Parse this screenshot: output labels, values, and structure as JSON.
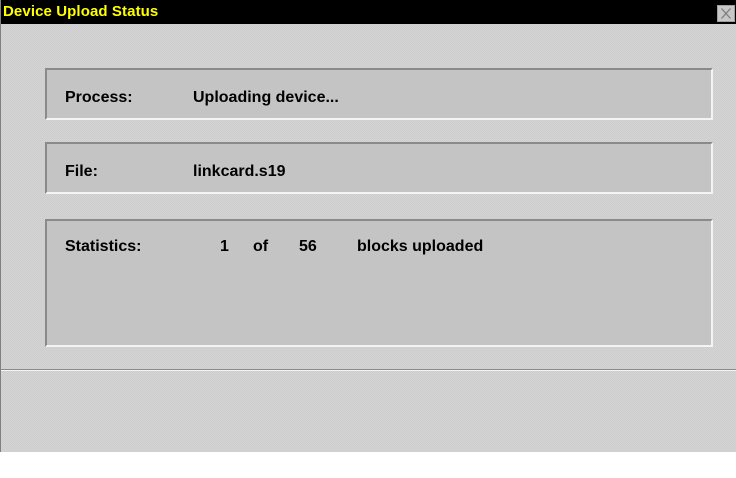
{
  "window": {
    "title": "Device Upload Status"
  },
  "process": {
    "label": "Process:",
    "value": "Uploading device..."
  },
  "file": {
    "label": "File:",
    "value": "linkcard.s19"
  },
  "statistics": {
    "label": "Statistics:",
    "current": "1",
    "of_label": "of",
    "total": "56",
    "unit_label": "blocks uploaded"
  },
  "colors": {
    "titlebar_bg": "#000000",
    "title_text": "#ffff00",
    "window_bg": "#d4d4d4",
    "panel_bg": "#c4c4c4"
  },
  "icons": {
    "close": "close-icon"
  }
}
